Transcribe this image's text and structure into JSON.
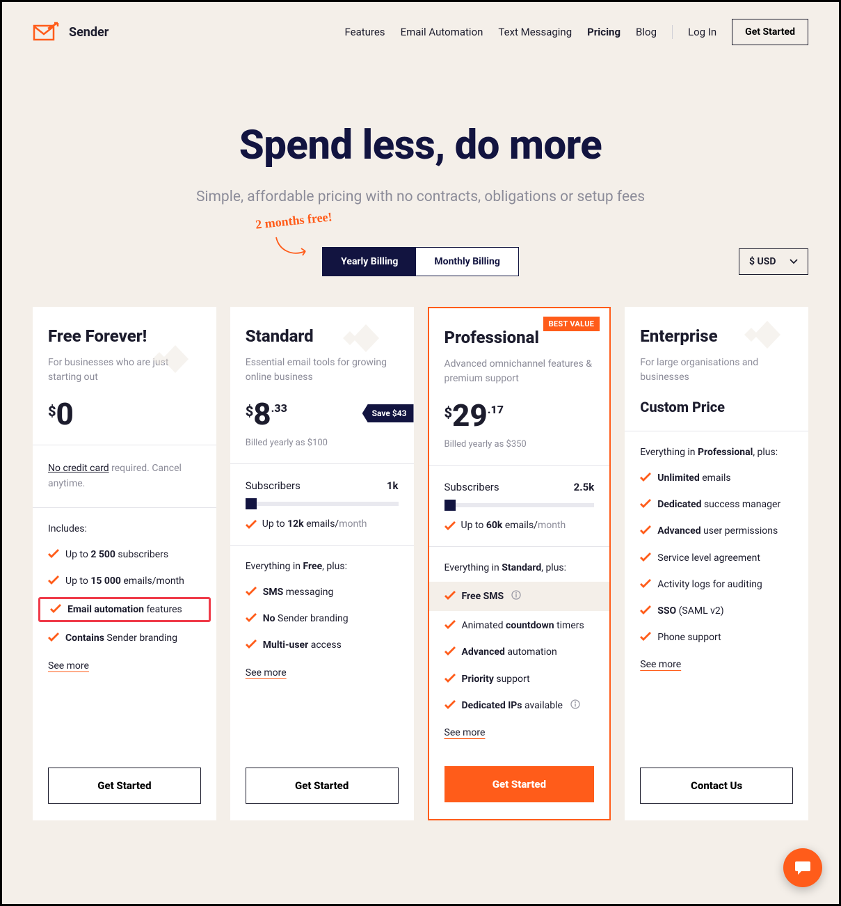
{
  "brand": {
    "name": "Sender"
  },
  "nav": {
    "links": [
      "Features",
      "Email Automation",
      "Text Messaging",
      "Pricing",
      "Blog"
    ],
    "active_index": 3,
    "login": "Log In",
    "cta": "Get Started"
  },
  "hero": {
    "title": "Spend less, do more",
    "subtitle": "Simple, affordable pricing with no contracts, obligations or setup fees"
  },
  "promo_badge": "2 months free!",
  "billing": {
    "yearly": "Yearly Billing",
    "monthly": "Monthly Billing",
    "active": "yearly"
  },
  "currency": {
    "label": "$ USD"
  },
  "plans": {
    "free": {
      "name": "Free Forever!",
      "desc": "For businesses who are just starting out",
      "price_whole": "0",
      "no_card_html": "<u>No credit card</u> required. Cancel anytime.",
      "includes_label": "Includes:",
      "features": [
        {
          "html": "Up to <span class='bolded'>2 500</span> subscribers"
        },
        {
          "html": "Up to <span class='bolded'>15 000</span> emails/month"
        },
        {
          "html": "<span class='bolded'>Email automation</span> features",
          "highlight": true
        },
        {
          "html": "<span class='bolded'>Contains</span> Sender branding"
        }
      ],
      "see_more": "See more",
      "cta": "Get Started"
    },
    "standard": {
      "name": "Standard",
      "desc": "Essential email tools for growing online business",
      "price_whole": "8",
      "price_cents": ".33",
      "save": "Save $43",
      "billed": "Billed yearly as $100",
      "subscribers_label": "Subscribers",
      "subscribers_count": "1k",
      "emails": {
        "prefix": "Up to ",
        "count": "12k",
        "unit": " emails/",
        "period": "month"
      },
      "includes_html": "Everything in <span class='includes-bold'>Free</span>, plus:",
      "features": [
        {
          "html": "<span class='bolded'>SMS</span> messaging"
        },
        {
          "html": "<span class='bolded'>No</span> Sender branding"
        },
        {
          "html": "<span class='bolded'>Multi-user</span> access"
        }
      ],
      "see_more": "See more",
      "cta": "Get Started"
    },
    "professional": {
      "name": "Professional",
      "badge": "BEST VALUE",
      "desc": "Advanced omnichannel features & premium support",
      "price_whole": "29",
      "price_cents": ".17",
      "billed": "Billed yearly as $350",
      "subscribers_label": "Subscribers",
      "subscribers_count": "2.5k",
      "emails": {
        "prefix": "Up to ",
        "count": "60k",
        "unit": " emails/",
        "period": "month"
      },
      "includes_html": "Everything in <span class='includes-bold'>Standard</span>, plus:",
      "features": [
        {
          "html": "<span class='bolded'>Free SMS</span>",
          "info": true,
          "shaded": true
        },
        {
          "html": "Animated <span class='bolded'>countdown</span> timers"
        },
        {
          "html": "<span class='bolded'>Advanced</span> automation"
        },
        {
          "html": "<span class='bolded'>Priority</span> support"
        },
        {
          "html": "<span class='bolded'>Dedicated IPs</span> available",
          "info": true
        }
      ],
      "see_more": "See more",
      "cta": "Get Started"
    },
    "enterprise": {
      "name": "Enterprise",
      "desc": "For large organisations and businesses",
      "custom_price": "Custom Price",
      "includes_html": "Everything in <span class='includes-bold'>Professional</span>, plus:",
      "features": [
        {
          "html": "<span class='bolded'>Unlimited</span> emails"
        },
        {
          "html": "<span class='bolded'>Dedicated</span> success manager"
        },
        {
          "html": "<span class='bolded'>Advanced</span> user permissions"
        },
        {
          "html": "Service level agreement"
        },
        {
          "html": "Activity logs for auditing"
        },
        {
          "html": "<span class='bolded'>SSO</span> (SAML v2)"
        },
        {
          "html": "Phone support"
        }
      ],
      "see_more": "See more",
      "cta": "Contact Us"
    }
  }
}
